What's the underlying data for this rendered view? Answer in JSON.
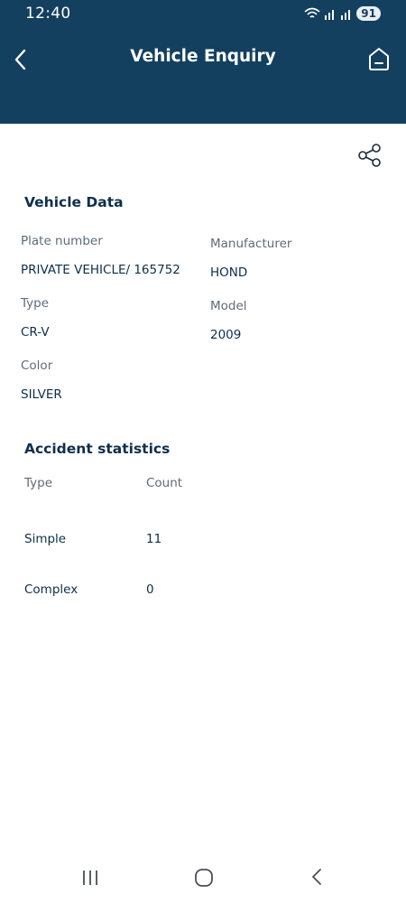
{
  "status_bar": {
    "time": "12:40",
    "battery": "91"
  },
  "header": {
    "title": "Vehicle Enquiry"
  },
  "vehicle_data": {
    "section_title": "Vehicle Data",
    "fields": {
      "plate_number": {
        "label": "Plate number",
        "value": "PRIVATE VEHICLE/ 165752"
      },
      "manufacturer": {
        "label": "Manufacturer",
        "value": "HOND"
      },
      "type": {
        "label": "Type",
        "value": "CR-V"
      },
      "model": {
        "label": "Model",
        "value": "2009"
      },
      "color": {
        "label": "Color",
        "value": "SILVER"
      }
    }
  },
  "accident_statistics": {
    "section_title": "Accident statistics",
    "columns": [
      "Type",
      "Count"
    ],
    "rows": [
      {
        "type": "Simple",
        "count": "11"
      },
      {
        "type": "Complex",
        "count": "0"
      }
    ]
  },
  "icons": {
    "back": "chevron-left-icon",
    "home": "home-icon",
    "share": "share-icon",
    "nav_recent": "recent-apps-icon",
    "nav_home": "home-circle-icon",
    "nav_back": "nav-back-icon"
  },
  "colors": {
    "header_bg": "#14405f",
    "header_text": "#ffffff",
    "text_primary": "#0d2f4b",
    "text_secondary": "#5e6c79"
  }
}
